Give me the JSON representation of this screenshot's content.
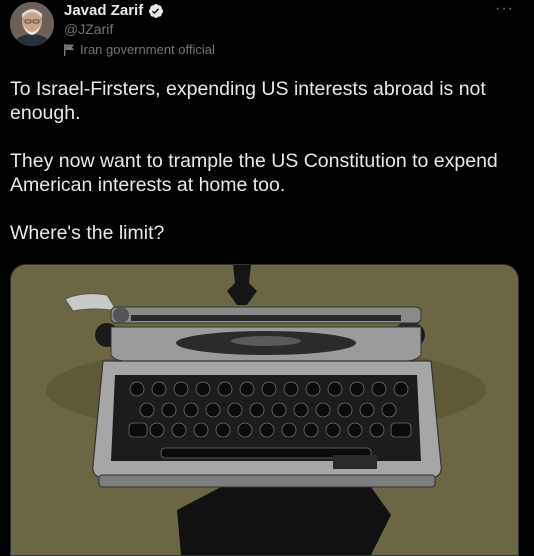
{
  "author": {
    "name": "Javad Zarif",
    "handle": "@JZarif",
    "label": "Iran government official",
    "verified_icon": "verified-badge-icon",
    "label_icon": "flag-icon"
  },
  "more_label": "···",
  "tweet": {
    "paragraphs": [
      "To Israel-Firsters, expending US interests abroad is not enough.",
      "They now want to trample the US Constitution to expend American interests at home too.",
      "Where's the limit?"
    ]
  },
  "media": {
    "subject": "typewriter-image",
    "background_color": "#6b6745"
  },
  "colors": {
    "background": "#000000",
    "text": "#e7e9ea",
    "secondary": "#71767b",
    "verified": "#1d9bf0"
  }
}
